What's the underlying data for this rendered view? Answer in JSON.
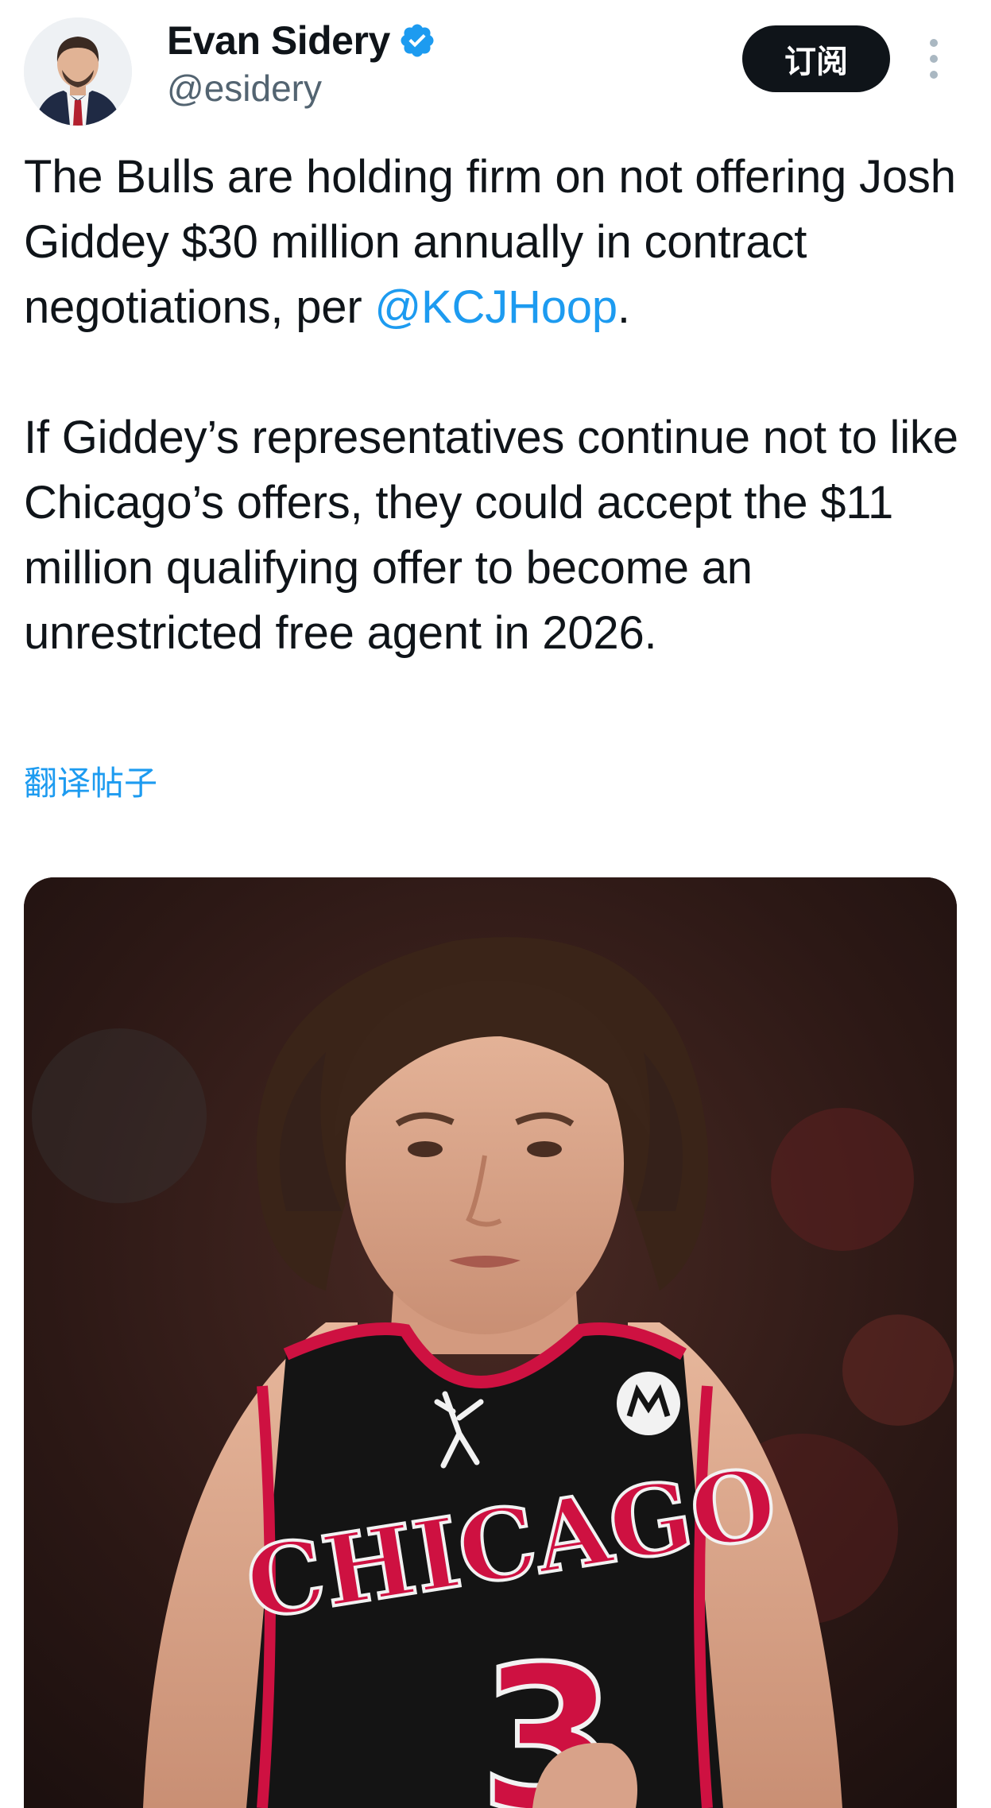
{
  "author": {
    "display_name": "Evan Sidery",
    "handle": "@esidery",
    "verified": true,
    "avatar_icon": "profile-photo",
    "verified_icon": "verified-badge-icon"
  },
  "actions": {
    "subscribe_label": "订阅",
    "more_icon": "more-vertical-icon"
  },
  "tweet": {
    "para1_prefix": "The Bulls are holding firm on not offering Josh Giddey $30 million annually in contract negotiations, per ",
    "para1_mention": "@KCJHoop",
    "para1_suffix": ".",
    "para2": "If Giddey’s representatives continue not to like Chicago’s offers, they could accept the $11 million qualifying offer to become an unrestricted free agent in 2026.",
    "translate_label": "翻译帖子"
  },
  "media": {
    "jersey_text": "CHICAGO",
    "jersey_number": "3"
  },
  "colors": {
    "accent": "#1d9bf0",
    "text_primary": "#0f1419",
    "text_secondary": "#536471",
    "button_bg": "#0f1419",
    "jersey_red": "#ce1141",
    "jersey_black": "#141414"
  }
}
